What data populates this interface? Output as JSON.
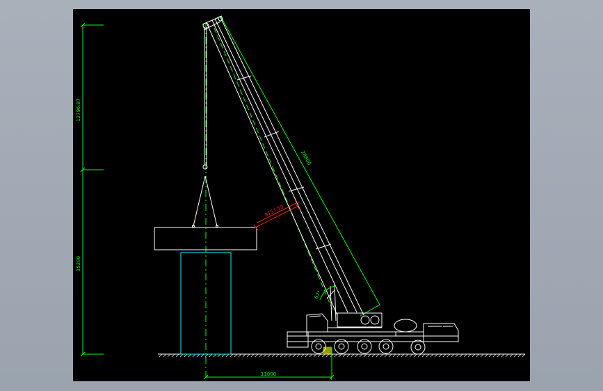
{
  "drawing": {
    "dimensions": {
      "upper_height": "12796.87",
      "lower_height": "15200",
      "boom_length": "28800",
      "hook_distance": "8157.59",
      "horizontal_offset": "11000",
      "boom_angle": "67°"
    }
  },
  "colors": {
    "background": "#000000",
    "dimension": "#00ff00",
    "geometry": "#ffffff",
    "pier": "#00ffff",
    "centerline": "#00ff00",
    "annotation": "#ff2020",
    "hook_marker": "#ffff00",
    "window_frame": "#9aa3ae"
  }
}
